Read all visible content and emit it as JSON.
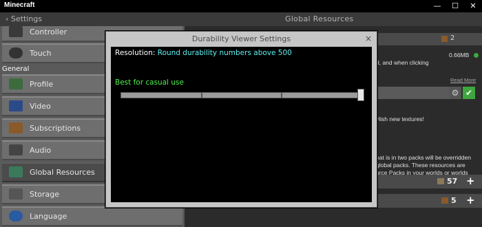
{
  "window": {
    "title": "Minecraft",
    "minimize_glyph": "—",
    "maximize_glyph": "☐",
    "close_glyph": "✕"
  },
  "header": {
    "back_label": "Settings",
    "title": "Global Resources"
  },
  "sidebar": {
    "items_top": [
      {
        "label": "Controller",
        "icon": "controller-icon"
      },
      {
        "label": "Touch",
        "icon": "touch-icon"
      }
    ],
    "section_label": "General",
    "items": [
      {
        "label": "Profile",
        "icon": "profile-icon"
      },
      {
        "label": "Video",
        "icon": "video-icon"
      },
      {
        "label": "Subscriptions",
        "icon": "subscriptions-icon"
      },
      {
        "label": "Audio",
        "icon": "audio-icon"
      },
      {
        "label": "Global Resources",
        "icon": "global-resources-icon",
        "selected": true
      },
      {
        "label": "Storage",
        "icon": "storage-icon"
      },
      {
        "label": "Language",
        "icon": "language-icon"
      }
    ]
  },
  "right_panel": {
    "count_top": "2",
    "size": "0.66MB",
    "text_line1": "d, and when clicking",
    "read_more": "Read More",
    "text_stylish": "ylish new textures!",
    "text_lines": [
      "hat is in two packs will be overridden",
      " global packs. These resources are",
      "urce Packs in your worlds or worlds"
    ],
    "count_a": "57",
    "count_b": "5",
    "plus": "+"
  },
  "dialog": {
    "title": "Durability Viewer Settings",
    "close": "×",
    "resolution_label": "Resolution:",
    "resolution_value": "Round durability numbers above 500",
    "hint": "Best for casual use",
    "slider_level": 1.0,
    "slider_steps": 4
  },
  "colors": {
    "accent_green": "#4ff24f",
    "accent_cyan": "#5ff0f0",
    "confirm_green": "#3ea63e"
  }
}
